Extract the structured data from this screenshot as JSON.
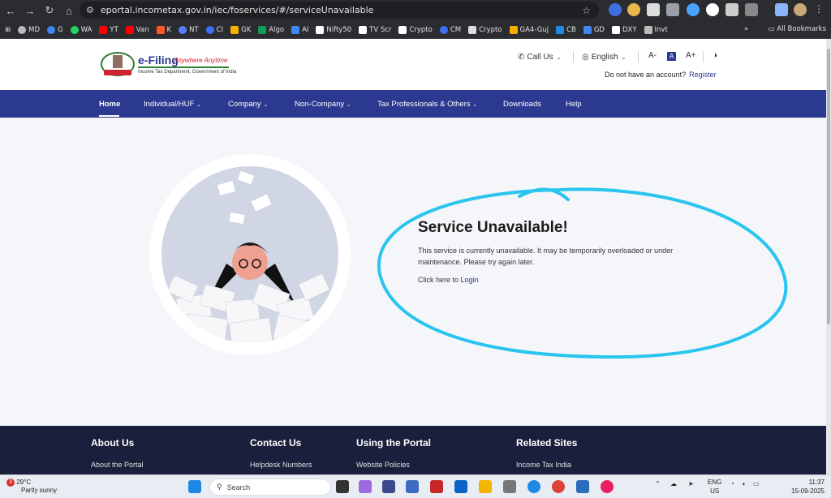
{
  "browser": {
    "url": "eportal.incometax.gov.in/iec/foservices/#/serviceUnavailable",
    "bookmarks": [
      "MD",
      "G",
      "WA",
      "YT",
      "Van",
      "K",
      "NT",
      "CI",
      "GK",
      "Algo",
      "AI",
      "Nifty50",
      "TV Scr",
      "Crypto",
      "CM",
      "Crypto",
      "GA4-Guj",
      "CB",
      "GD",
      "DXY",
      "Invt"
    ],
    "all_bookmarks": "All Bookmarks"
  },
  "header": {
    "logo_title": "e-Filing",
    "logo_tag": "Anywhere Anytime",
    "logo_sub": "Income Tax Department, Government of India",
    "call_us": "Call Us",
    "language": "English",
    "font_small": "A-",
    "font_normal": "A",
    "font_large": "A+",
    "no_account": "Do not have an account?",
    "register": "Register"
  },
  "nav": {
    "items": [
      "Home",
      "Individual/HUF",
      "Company",
      "Non-Company",
      "Tax Professionals & Others",
      "Downloads",
      "Help"
    ]
  },
  "message": {
    "title": "Service Unavailable!",
    "body": "This service is currently unavailable. It may be temporarily overloaded or under maintenance. Please try again later.",
    "login_prefix": "Click here to",
    "login_link": "Login"
  },
  "footer": {
    "headings": [
      "About Us",
      "Contact Us",
      "Using the Portal",
      "Related Sites"
    ],
    "links": [
      "About the Portal",
      "Helpdesk Numbers",
      "Website Policies",
      "Income Tax India"
    ]
  },
  "taskbar": {
    "temperature": "29°C",
    "weather": "Partly sunny",
    "weather_badge": "3",
    "search": "Search",
    "lang": "ENG",
    "region": "US",
    "time": "11:37",
    "date": "15-09-2025"
  },
  "colors": {
    "nav_blue": "#2b3990",
    "footer_navy": "#1a1f3c",
    "annotation_cyan": "#29c4ef"
  }
}
